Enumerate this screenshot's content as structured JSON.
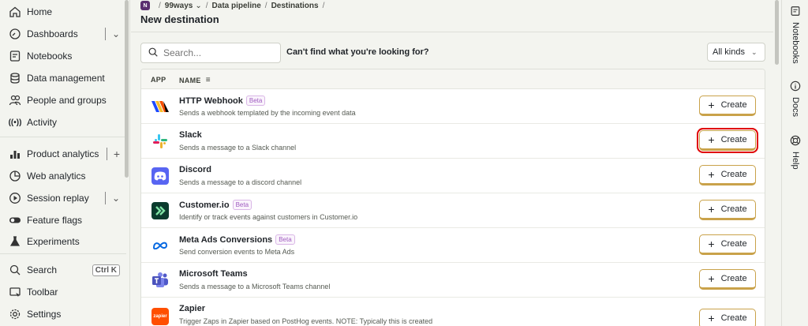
{
  "sidebar": {
    "items": [
      {
        "label": "Home",
        "icon": "home-icon"
      },
      {
        "label": "Dashboards",
        "icon": "dashboard-icon"
      },
      {
        "label": "Notebooks",
        "icon": "notebook-icon"
      },
      {
        "label": "Data management",
        "icon": "database-icon"
      },
      {
        "label": "People and groups",
        "icon": "people-icon"
      },
      {
        "label": "Activity",
        "icon": "activity-icon"
      },
      {
        "label": "Product analytics",
        "icon": "bar-chart-icon"
      },
      {
        "label": "Web analytics",
        "icon": "pie-chart-icon"
      },
      {
        "label": "Session replay",
        "icon": "play-icon"
      },
      {
        "label": "Feature flags",
        "icon": "toggle-icon"
      },
      {
        "label": "Experiments",
        "icon": "flask-icon"
      },
      {
        "label": "Search",
        "icon": "search-icon",
        "shortcut": "Ctrl K"
      },
      {
        "label": "Toolbar",
        "icon": "toolbar-icon"
      },
      {
        "label": "Settings",
        "icon": "gear-icon"
      }
    ]
  },
  "breadcrumb": {
    "project_initial": "N",
    "project": "99ways",
    "section": "Data pipeline",
    "page": "Destinations"
  },
  "page": {
    "title": "New destination"
  },
  "toolbar": {
    "search_placeholder": "Search...",
    "cant_find": "Can't find what you're looking for?",
    "kinds_filter": "All kinds"
  },
  "table": {
    "columns": [
      "APP",
      "NAME"
    ],
    "create_label": "Create",
    "beta_label": "Beta",
    "rows": [
      {
        "name": "HTTP Webhook",
        "beta": true,
        "description": "Sends a webhook templated by the incoming event data",
        "logo": "webhook-logo"
      },
      {
        "name": "Slack",
        "beta": false,
        "description": "Sends a message to a Slack channel",
        "logo": "slack-logo"
      },
      {
        "name": "Discord",
        "beta": false,
        "description": "Sends a message to a discord channel",
        "logo": "discord-logo"
      },
      {
        "name": "Customer.io",
        "beta": true,
        "description": "Identify or track events against customers in Customer.io",
        "logo": "customerio-logo"
      },
      {
        "name": "Meta Ads Conversions",
        "beta": true,
        "description": "Send conversion events to Meta Ads",
        "logo": "meta-logo"
      },
      {
        "name": "Microsoft Teams",
        "beta": false,
        "description": "Sends a message to a Microsoft Teams channel",
        "logo": "teams-logo"
      },
      {
        "name": "Zapier",
        "beta": false,
        "description": "Trigger Zaps in Zapier based on PostHog events. NOTE: Typically this is created",
        "logo": "zapier-logo",
        "logo_text": "zapier"
      }
    ]
  },
  "right_rail": {
    "items": [
      {
        "label": "Notebooks",
        "icon": "notebook-icon"
      },
      {
        "label": "Docs",
        "icon": "info-icon"
      },
      {
        "label": "Help",
        "icon": "lifebuoy-icon"
      }
    ]
  },
  "colors": {
    "accent_border": "#c9a24a",
    "highlight": "#e00000",
    "beta": "#a05cc0"
  }
}
